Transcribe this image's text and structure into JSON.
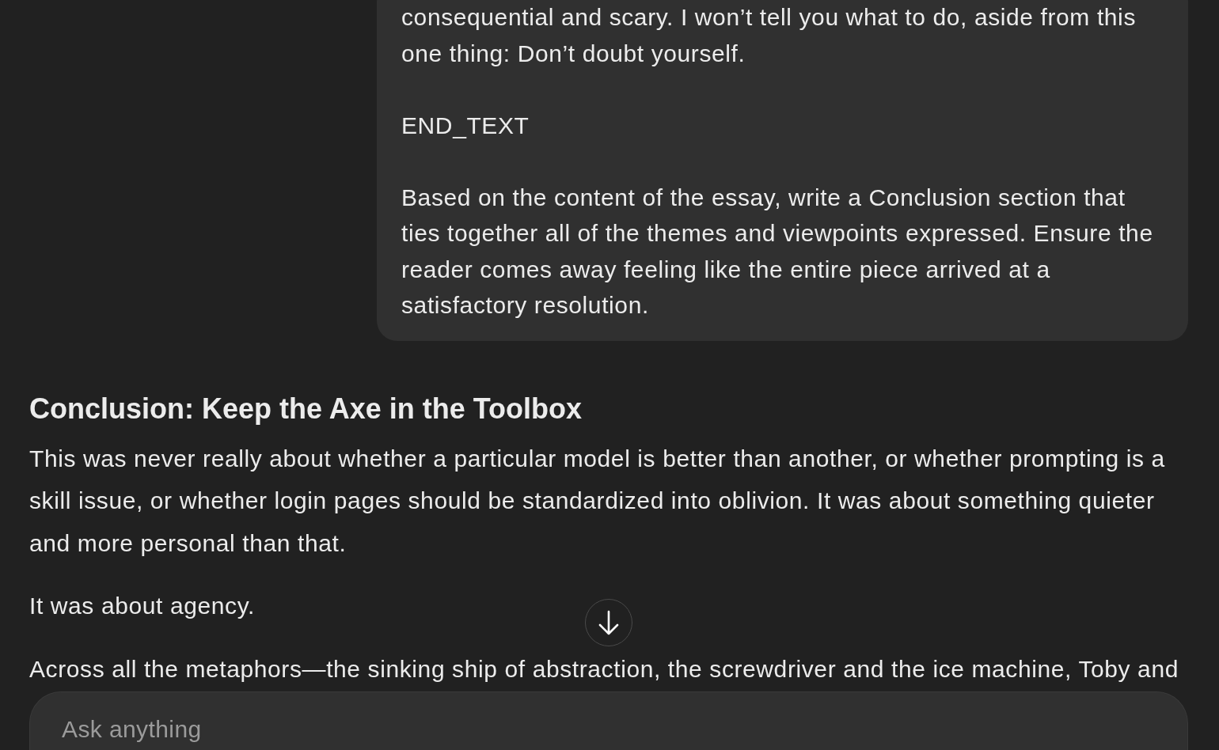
{
  "user_message": {
    "paragraphs": [
      {
        "lines": [
          "consequential and scary. I won’t tell you what to do, aside from this",
          "one thing: Don’t doubt yourself."
        ]
      },
      {
        "lines": [
          "END_TEXT"
        ]
      },
      {
        "lines": [
          "Based on the content of the essay, write a Conclusion section that",
          "ties together all of the themes and viewpoints expressed. Ensure the",
          "reader comes away feeling like the entire piece arrived at a",
          "satisfactory resolution."
        ]
      }
    ]
  },
  "assistant_message": {
    "heading": "Conclusion: Keep the Axe in the Toolbox",
    "paragraphs": [
      {
        "lines": [
          "This was never really about whether a particular model is better than another, or whether prompting is a",
          "skill issue, or whether login pages should be standardized into oblivion. It was about something quieter",
          "and more personal than that."
        ]
      },
      {
        "lines": [
          "It was about agency."
        ]
      },
      {
        "lines": [
          "Across all the metaphors—the sinking ship of abstraction, the screwdriver and the ice machine, Toby and"
        ]
      }
    ]
  },
  "composer": {
    "placeholder": "Ask anything"
  }
}
